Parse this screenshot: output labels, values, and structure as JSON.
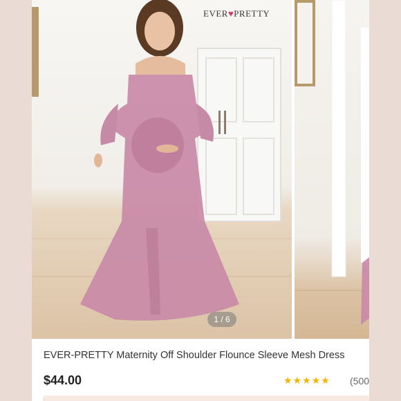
{
  "brand": {
    "logo_left": "EVER",
    "logo_right": "PRETTY"
  },
  "gallery": {
    "counter": "1 / 6",
    "dress_color": "#c98aa7"
  },
  "product": {
    "title": "EVER-PRETTY Maternity Off Shoulder Flounce Sleeve Mesh Dress",
    "price": "$44.00",
    "rating": {
      "stars_display": "★★★★★",
      "value": 4.5,
      "reviews": "(500"
    }
  },
  "colors": {
    "accent": "#e0356a",
    "star": "#f5b400"
  }
}
